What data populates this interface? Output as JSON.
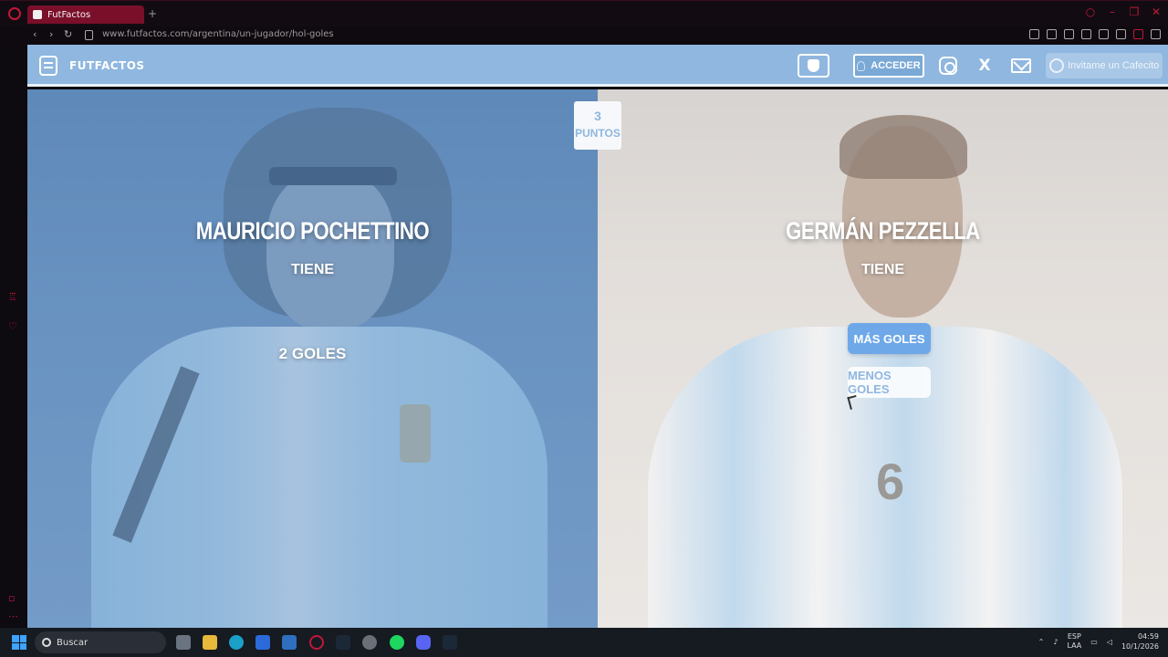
{
  "browser": {
    "tab_title": "FutFactos",
    "new_tab": "+",
    "url": "www.futfactos.com/argentina/un-jugador/hol-goles"
  },
  "header": {
    "site_name": "FUTFACTOS",
    "login_label": "ACCEDER",
    "coffee_label": "Invitame un Cafecito",
    "x_glyph": "X"
  },
  "game": {
    "points_value": "3",
    "points_label": "PUNTOS",
    "left_player": {
      "name": "MAURICIO POCHETTINO",
      "verb": "TIENE",
      "goals": "2 GOLES"
    },
    "right_player": {
      "name": "GERMÁN PEZZELLA",
      "verb": "TIENE",
      "more_label": "MÁS GOLES",
      "less_label": "MENOS GOLES",
      "shirt_number": "6"
    }
  },
  "taskbar": {
    "search_placeholder": "Buscar",
    "lang_line1": "ESP",
    "lang_line2": "LAA",
    "time": "04:59",
    "date": "10/1/2026"
  },
  "colors": {
    "accent": "#8fb7df",
    "more_button": "#6ea8e8",
    "opera_red": "#c0183a"
  }
}
